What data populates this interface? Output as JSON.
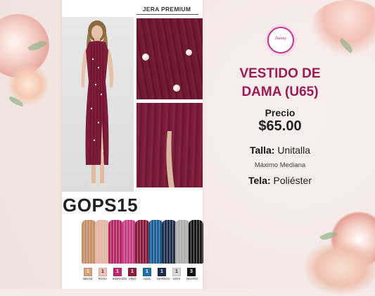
{
  "card": {
    "brand": "JERA PREMIUM",
    "product_code": "GOPS15"
  },
  "logo": {
    "text": "Danny"
  },
  "product": {
    "title": "VESTIDO DE DAMA (U65)",
    "price_label": "Precio",
    "price": "$65.00",
    "size_label": "Talla:",
    "size_value": "Unitalla",
    "size_note": "Máximo Mediana",
    "fabric_label": "Tela:",
    "fabric_value": "Poliéster"
  },
  "colors": [
    {
      "count": "1",
      "name": "BEIGE",
      "hex": "#d9a47c"
    },
    {
      "count": "1",
      "name": "ROSA",
      "hex": "#efc1b5"
    },
    {
      "count": "1",
      "name": "MORADO",
      "hex": "#c4266f"
    },
    {
      "count": "1",
      "name": "VINO",
      "hex": "#8e1d3c"
    },
    {
      "count": "1",
      "name": "AZUL",
      "hex": "#1f6fa8"
    },
    {
      "count": "1",
      "name": "MARINO",
      "hex": "#1e2c4d"
    },
    {
      "count": "1",
      "name": "GRIS",
      "hex": "#d7d7d7"
    },
    {
      "count": "3",
      "name": "NEGRO",
      "hex": "#111111"
    }
  ],
  "dress_colors": [
    "#c99167",
    "#e8b6a5",
    "#b82a66",
    "#c93d86",
    "#8a1c3a",
    "#1d5f96",
    "#22304f",
    "#b0b0b0",
    "#1a1a1a"
  ]
}
